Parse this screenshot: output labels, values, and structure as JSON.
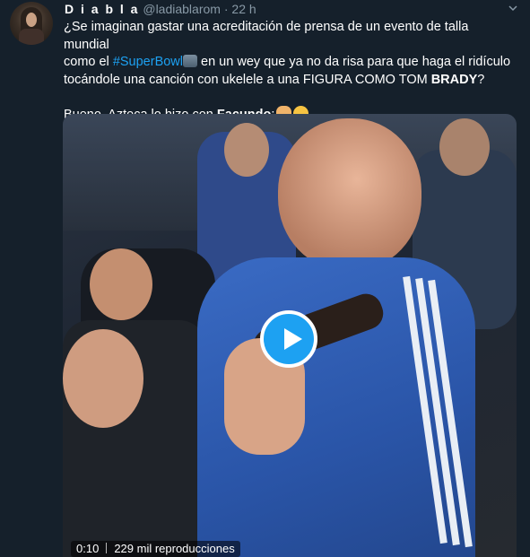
{
  "tweet": {
    "name": "D i a b l a",
    "handle": "@ladiablarom",
    "dot": "·",
    "time": "22 h",
    "line1_a": "¿Se imaginan gastar una acreditación de prensa de un evento de talla mundial",
    "line2_a": "como el ",
    "hashtag": "#SuperBowl",
    "line2_b": " en un wey que ya no da risa para que haga el ridículo",
    "line3_a": "tocándole una canción con ukelele a una FIGURA COMO TOM ",
    "line3_bold": "BRADY",
    "line3_b": "?",
    "para2_a": "Bueno, Azteca lo hizo con ",
    "para2_bold": "Facundo",
    "para2_b": ":"
  },
  "video": {
    "elapsed": "0:10",
    "views": "229 mil reproducciones"
  },
  "icons": {
    "play": "play-icon",
    "chevron": "chevron-down-icon",
    "brand_color": "#1da1f2"
  }
}
